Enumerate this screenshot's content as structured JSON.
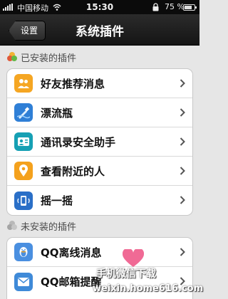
{
  "status_bar": {
    "carrier": "中国移动",
    "time": "15:30",
    "battery_percent": "75 %",
    "battery_level": 0.75
  },
  "nav": {
    "back_label": "设置",
    "title": "系统插件"
  },
  "installed": {
    "header": "已安装的插件",
    "items": [
      {
        "label": "好友推荐消息",
        "icon": "contacts-recommend-icon",
        "color": "#f5a623"
      },
      {
        "label": "漂流瓶",
        "icon": "drift-bottle-icon",
        "color": "#2f7fd6"
      },
      {
        "label": "通讯录安全助手",
        "icon": "contacts-security-icon",
        "color": "#16a0b4"
      },
      {
        "label": "查看附近的人",
        "icon": "location-pin-icon",
        "color": "#f4a11d"
      },
      {
        "label": "摇一摇",
        "icon": "shake-phone-icon",
        "color": "#2a6fc7"
      }
    ]
  },
  "not_installed": {
    "header": "未安装的插件",
    "items": [
      {
        "label": "QQ离线消息",
        "icon": "qq-penguin-icon",
        "color": "#4a8fe0"
      },
      {
        "label": "QQ邮箱提醒",
        "icon": "qq-mail-icon",
        "color": "#3f8ad8"
      }
    ]
  },
  "watermark": {
    "line1": "手机微信下载",
    "line2": "weixin.home616.com"
  }
}
